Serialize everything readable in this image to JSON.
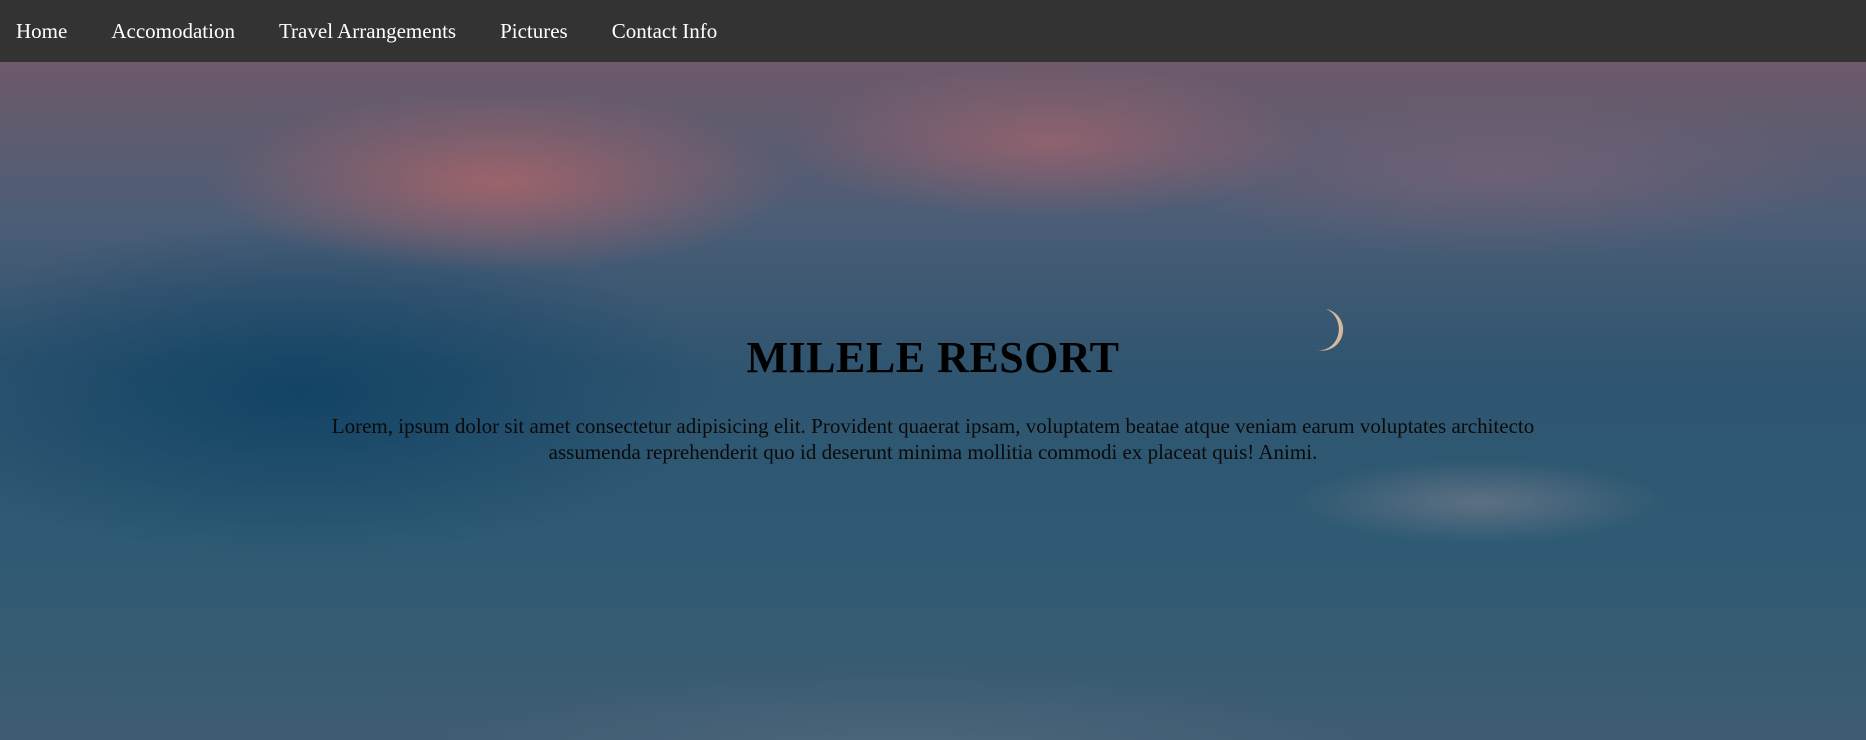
{
  "nav": {
    "items": [
      {
        "label": "Home"
      },
      {
        "label": "Accomodation"
      },
      {
        "label": "Travel Arrangements"
      },
      {
        "label": "Pictures"
      },
      {
        "label": "Contact Info"
      }
    ]
  },
  "hero": {
    "title": "MILELE RESORT",
    "text": "Lorem, ipsum dolor sit amet consectetur adipisicing elit. Provident quaerat ipsam, voluptatem beatae atque veniam earum voluptates architecto assumenda reprehenderit quo id deserunt minima mollitia commodi ex placeat quis! Animi.",
    "background_icon": "crescent-moon-icon"
  },
  "colors": {
    "navbar_bg": "#333333",
    "nav_text": "#ffffff",
    "hero_text": "#000000"
  }
}
